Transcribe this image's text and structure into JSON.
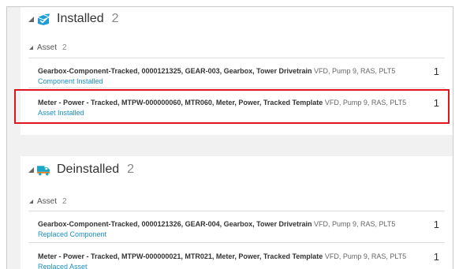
{
  "installed": {
    "title": "Installed",
    "count": "2",
    "subgroup": {
      "label": "Asset",
      "count": "2"
    },
    "items": [
      {
        "title": "Gearbox-Component-Tracked, 0000121325, GEAR-003, Gearbox, Tower Drivetrain",
        "location": "VFD, Pump 9, RAS, PLT5",
        "status": "Component Installed",
        "quantity": "1"
      },
      {
        "title": "Meter - Power - Tracked, MTPW-000000060, MTR060, Meter, Power, Tracked Template",
        "location": "VFD, Pump 9, RAS, PLT5",
        "status": "Asset Installed",
        "quantity": "1"
      }
    ]
  },
  "deinstalled": {
    "title": "Deinstalled",
    "count": "2",
    "subgroup": {
      "label": "Asset",
      "count": "2"
    },
    "items": [
      {
        "title": "Gearbox-Component-Tracked, 0000121326, GEAR-004, Gearbox, Tower Drivetrain",
        "location": "VFD, Pump 9, RAS, PLT5",
        "status": "Replaced Component",
        "quantity": "1"
      },
      {
        "title": "Meter - Power - Tracked, MTPW-000000021, MTR021, Meter, Power, Tracked Template",
        "location": "VFD, Pump 9, RAS, PLT5",
        "status": "Replaced Asset",
        "quantity": "1"
      }
    ]
  },
  "colors": {
    "accent": "#1a8fc6",
    "highlight_border": "#e0141d",
    "installed_icon": "#1f9bd7",
    "deinstalled_icon": "#19a7c9"
  },
  "icons": {
    "installed": "installed-box-check-icon",
    "deinstalled": "deinstalled-truck-icon"
  }
}
